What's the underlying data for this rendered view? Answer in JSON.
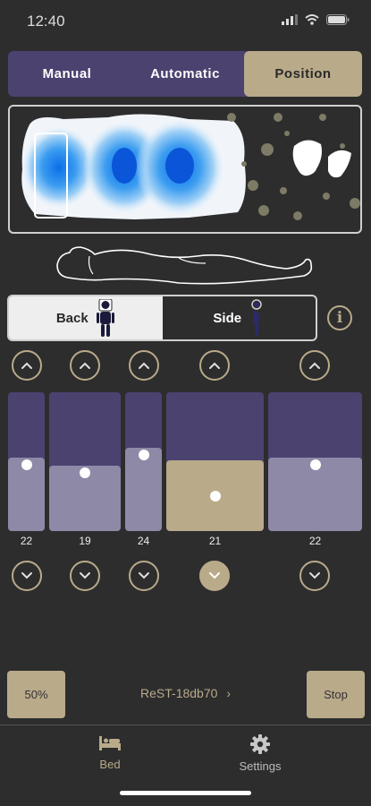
{
  "status": {
    "time": "12:40"
  },
  "tabs": [
    {
      "label": "Manual",
      "active": false
    },
    {
      "label": "Automatic",
      "active": false
    },
    {
      "label": "Position",
      "active": true
    }
  ],
  "position_toggle": {
    "back_label": "Back",
    "side_label": "Side",
    "selected": "Back"
  },
  "zones": [
    {
      "value": "22",
      "fill_fraction": 0.53,
      "selected": false
    },
    {
      "value": "19",
      "fill_fraction": 0.47,
      "selected": false
    },
    {
      "value": "24",
      "fill_fraction": 0.6,
      "selected": false
    },
    {
      "value": "21",
      "fill_fraction": 0.51,
      "selected": true
    },
    {
      "value": "22",
      "fill_fraction": 0.53,
      "selected": false
    }
  ],
  "controls": {
    "percent_label": "50%",
    "device_label": "ReST-18db70",
    "stop_label": "Stop"
  },
  "nav": [
    {
      "label": "Bed",
      "icon": "bed-icon",
      "active": true
    },
    {
      "label": "Settings",
      "icon": "gear-icon",
      "active": false
    }
  ],
  "colors": {
    "accent": "#b9aa8a",
    "purple": "#4b4270",
    "lavender": "#8f89a8",
    "background": "#2d2d2d"
  }
}
